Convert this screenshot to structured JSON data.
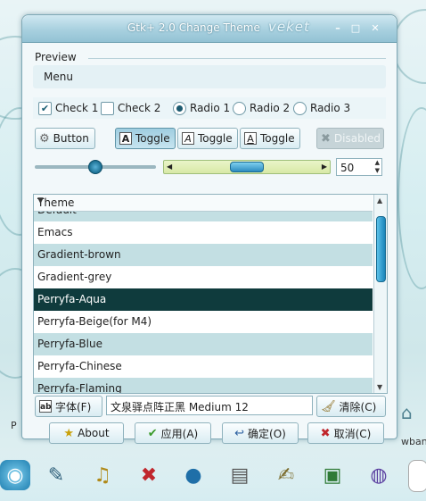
{
  "window": {
    "title": "Gtk+ 2.0 Change Theme",
    "brand": "veket",
    "minimize": "–",
    "maximize": "□",
    "close": "✕"
  },
  "preview": {
    "section_label": "Preview",
    "menu_label": "Menu",
    "check1": "Check 1",
    "check2": "Check 2",
    "radio1": "Radio 1",
    "radio2": "Radio 2",
    "radio3": "Radio 3",
    "button_label": "Button",
    "toggle1": "Toggle",
    "toggle2": "Toggle",
    "toggle3": "Toggle",
    "disabled_label": "Disabled",
    "spin_value": "50",
    "check1_checked": true,
    "check2_checked": false,
    "radio_selected": 1
  },
  "theme_list": {
    "header": "Theme",
    "rows": [
      "Default",
      "Emacs",
      "Gradient-brown",
      "Gradient-grey",
      "Perryfa-Aqua",
      "Perryfa-Beige(for M4)",
      "Perryfa-Blue",
      "Perryfa-Chinese",
      "Perryfa-Flaming"
    ],
    "selected": "Perryfa-Aqua"
  },
  "font": {
    "button_label": "字体(F)",
    "value": "文泉驿点阵正黑 Medium 12",
    "clear_label": "清除(C)"
  },
  "actions": {
    "about": "About",
    "apply": "应用(A)",
    "ok": "确定(O)",
    "cancel": "取消(C)"
  },
  "desktop": {
    "edge_left": "P",
    "edge_right": "wban"
  }
}
